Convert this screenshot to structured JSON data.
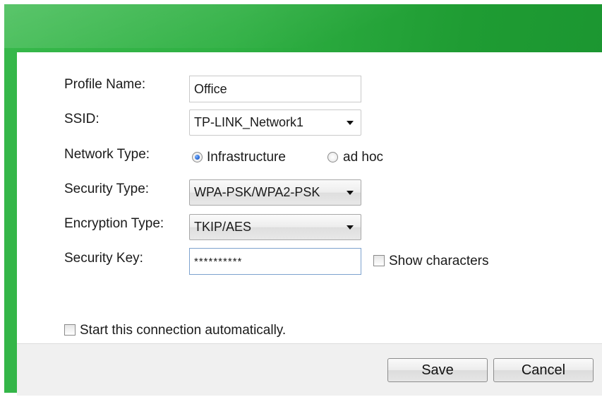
{
  "form": {
    "profile_name": {
      "label": "Profile Name:",
      "value": "Office"
    },
    "ssid": {
      "label": "SSID:",
      "value": "TP-LINK_Network1"
    },
    "network_type": {
      "label": "Network Type:",
      "options": [
        "Infrastructure",
        "ad hoc"
      ],
      "selected": "Infrastructure"
    },
    "security_type": {
      "label": "Security Type:",
      "value": "WPA-PSK/WPA2-PSK"
    },
    "encryption_type": {
      "label": "Encryption Type:",
      "value": "TKIP/AES"
    },
    "security_key": {
      "label": "Security Key:",
      "value": "**********",
      "show_characters_label": "Show characters",
      "show_characters_checked": false
    },
    "auto_start": {
      "label": "Start this connection automatically.",
      "checked": false
    }
  },
  "footer": {
    "save_label": "Save",
    "cancel_label": "Cancel"
  },
  "colors": {
    "title_bar_green": "#2fb043",
    "footer_bg": "#f0f0f0"
  }
}
